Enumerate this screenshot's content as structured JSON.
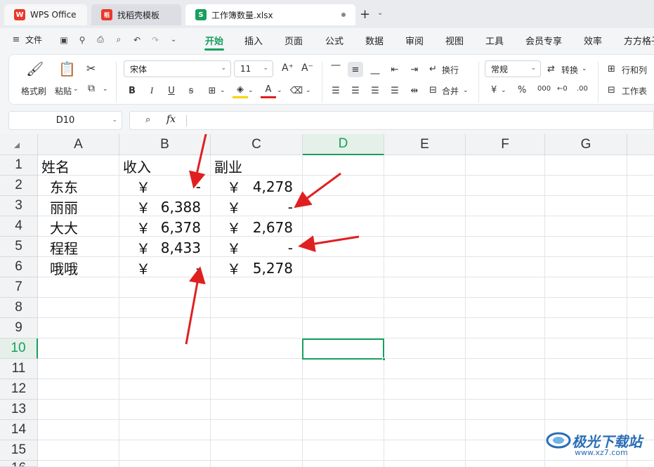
{
  "tabs": [
    {
      "label": "WPS Office",
      "logo": "W"
    },
    {
      "label": "找稻壳模板",
      "logo": "稻"
    },
    {
      "label": "工作簿数量.xlsx",
      "logo": "S"
    }
  ],
  "menu": {
    "file_label": "文件",
    "items": [
      "开始",
      "插入",
      "页面",
      "公式",
      "数据",
      "审阅",
      "视图",
      "工具",
      "会员专享",
      "效率",
      "方方格子"
    ],
    "active": "开始"
  },
  "ribbon": {
    "format_painter": "格式刷",
    "paste": "粘贴",
    "font_name": "宋体",
    "font_size": "11",
    "wrap": "换行",
    "merge": "合并",
    "number_format": "常规",
    "convert": "转换",
    "rows_cols": "行和列",
    "worksheet": "工作表",
    "bold": "B",
    "italic": "I",
    "underline": "U",
    "strike": "ꞩ",
    "currency": "¥",
    "percent": "%",
    "thousands": "000",
    "inc_dec": "←0",
    "dec_dec": ".00"
  },
  "formula_bar": {
    "name_box": "D10",
    "fx": "fx",
    "formula": ""
  },
  "sheet": {
    "columns": [
      "A",
      "B",
      "C",
      "D",
      "E",
      "F",
      "G"
    ],
    "selected_column": "D",
    "rows": [
      "1",
      "2",
      "3",
      "4",
      "5",
      "6",
      "7",
      "8",
      "9",
      "10",
      "11",
      "12",
      "13",
      "14",
      "15",
      "16"
    ],
    "selected_row": "10",
    "cells": {
      "A1": "姓名",
      "B1": "收入",
      "C1": "副业",
      "A2": "东东",
      "A3": "丽丽",
      "A4": "大大",
      "A5": "程程",
      "A6": "哦哦",
      "B2": "-",
      "B3": "6,388",
      "B4": "6,378",
      "B5": "8,433",
      "B6": "-",
      "C2": "4,278",
      "C3": "-",
      "C4": "2,678",
      "C5": "-",
      "C6": "5,278"
    },
    "currency_symbol": "￥"
  },
  "watermark": {
    "title": "极光下载站",
    "sub": "www.xz7.com"
  },
  "colors": {
    "accent": "#18a05e",
    "arrow": "#e02020"
  }
}
